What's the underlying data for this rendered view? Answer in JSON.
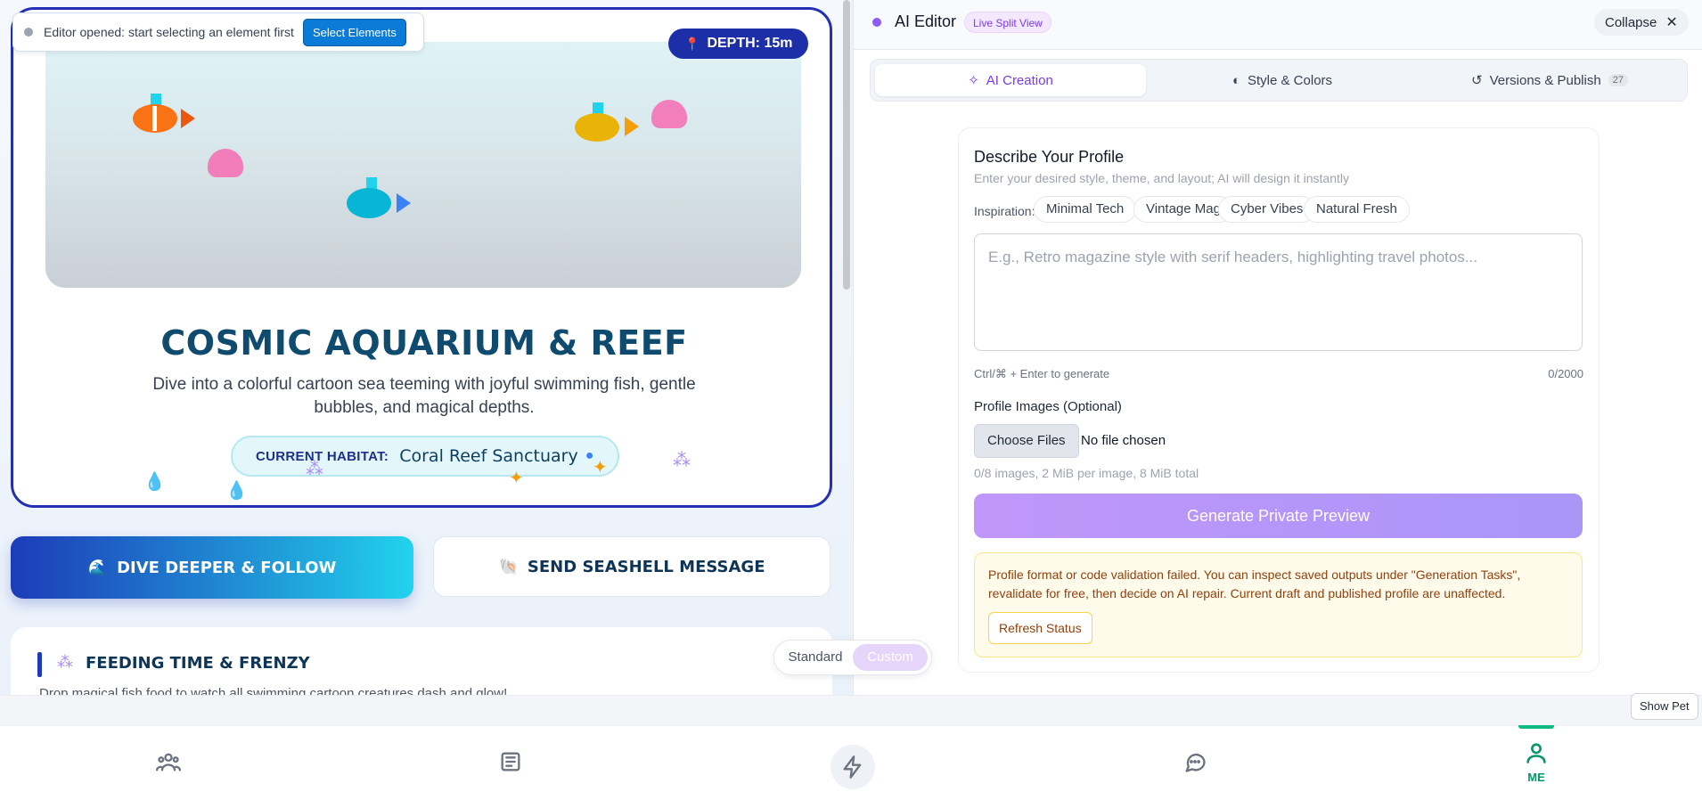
{
  "preview": {
    "banner_text": "Editor opened: start selecting an element first",
    "banner_button": "Select Elements",
    "depth_badge": "DEPTH: 15m",
    "hero_title": "COSMIC AQUARIUM & REEF",
    "hero_description": "Dive into a colorful cartoon sea teeming with joyful swimming fish, gentle bubbles, and magical depths.",
    "habitat_label": "CURRENT HABITAT:",
    "habitat_value": "Coral Reef Sanctuary",
    "follow_button": "DIVE DEEPER & FOLLOW",
    "message_button": "SEND SEASHELL MESSAGE",
    "feeding_title": "FEEDING TIME & FRENZY",
    "feeding_description": "Drop magical fish food to watch all swimming cartoon creatures dash and glow!",
    "mode_options": [
      "Standard",
      "Custom"
    ],
    "mode_selected": "Custom"
  },
  "editor": {
    "title": "AI Editor",
    "badge": "Live Split View",
    "collapse_label": "Collapse",
    "tabs": [
      {
        "label": "AI Creation",
        "icon": "sparkles-icon",
        "active": true
      },
      {
        "label": "Style & Colors",
        "icon": "palette-icon",
        "active": false
      },
      {
        "label": "Versions & Publish",
        "icon": "history-icon",
        "count": "27",
        "active": false
      }
    ],
    "form": {
      "title": "Describe Your Profile",
      "subtitle": "Enter your desired style, theme, and layout; AI will design it instantly",
      "inspiration_label": "Inspiration:",
      "chips": [
        "Minimal Tech",
        "Vintage Mag",
        "Cyber Vibes",
        "Natural Fresh"
      ],
      "prompt_placeholder": "E.g., Retro magazine style with serif headers, highlighting travel photos...",
      "prompt_value": "",
      "shortcut_hint": "Ctrl/⌘ + Enter to generate",
      "char_count": "0/2000",
      "images_label": "Profile Images (Optional)",
      "choose_files": "Choose Files",
      "no_file": "No file chosen",
      "images_hint": "0/8 images, 2 MiB per image, 8 MiB total",
      "generate_button": "Generate Private Preview",
      "warning_text": "Profile format or code validation failed. You can inspect saved outputs under \"Generation Tasks\", revalidate for free, then decide on AI repair. Current draft and published profile are unaffected.",
      "refresh_button": "Refresh Status"
    }
  },
  "nav": {
    "items": [
      {
        "icon": "community-icon"
      },
      {
        "icon": "news-icon"
      },
      {
        "icon": "lightning-icon"
      },
      {
        "icon": "chat-icon"
      },
      {
        "icon": "user-icon",
        "label": "ME",
        "active": true
      }
    ],
    "show_pet": "Show Pet"
  },
  "colors": {
    "accent_purple": "#7c3aed",
    "hero_border": "#2430b3",
    "active_nav": "#059669"
  }
}
